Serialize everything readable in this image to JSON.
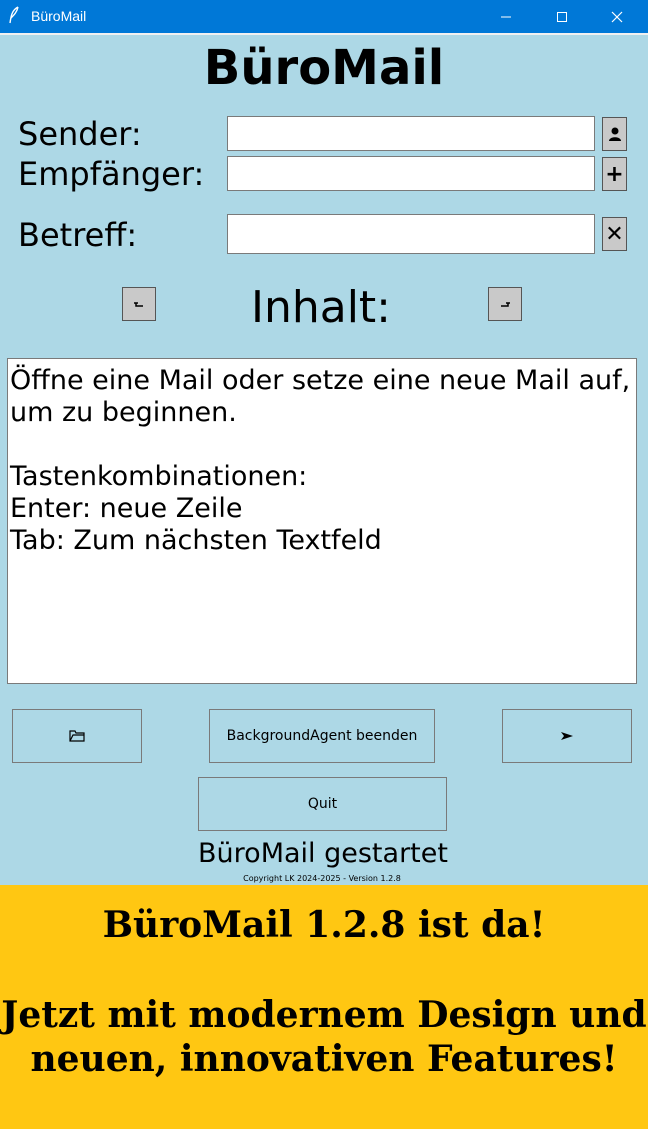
{
  "window": {
    "title": "BüroMail",
    "app_icon": "feather-icon",
    "controls": [
      "minimize-icon",
      "maximize-icon",
      "close-icon"
    ]
  },
  "header": {
    "title": "BüroMail"
  },
  "form": {
    "sender_label": "Sender:",
    "recipient_label": "Empfänger:",
    "subject_label": "Betreff:",
    "sender_value": "",
    "recipient_value": "",
    "subject_value": "",
    "contact_button": "person-icon",
    "add_button": "+",
    "clear_button": "✕"
  },
  "content": {
    "label": "Inhalt:",
    "undo_icon": "undo-icon",
    "redo_icon": "redo-icon",
    "text": "Öffne eine Mail oder setze eine neue Mail auf,\num zu beginnen.\n\nTastenkombinationen:\nEnter: neue Zeile\nTab: Zum nächsten Textfeld"
  },
  "buttons": {
    "open_icon": "folder-icon",
    "agent_label": "BackgroundAgent beenden",
    "send_icon": "send-arrow-icon",
    "quit_label": "Quit"
  },
  "status": {
    "text": "BüroMail gestartet",
    "copyright": "Copyright LK 2024-2025  -  Version 1.2.8"
  },
  "banner": {
    "line1": "BüroMail 1.2.8 ist da!",
    "line2": "Jetzt mit modernem Design und neuen, innovativen Features!"
  },
  "colors": {
    "background": "#add8e6",
    "titlebar": "#0078d7",
    "banner": "#ffc712"
  }
}
